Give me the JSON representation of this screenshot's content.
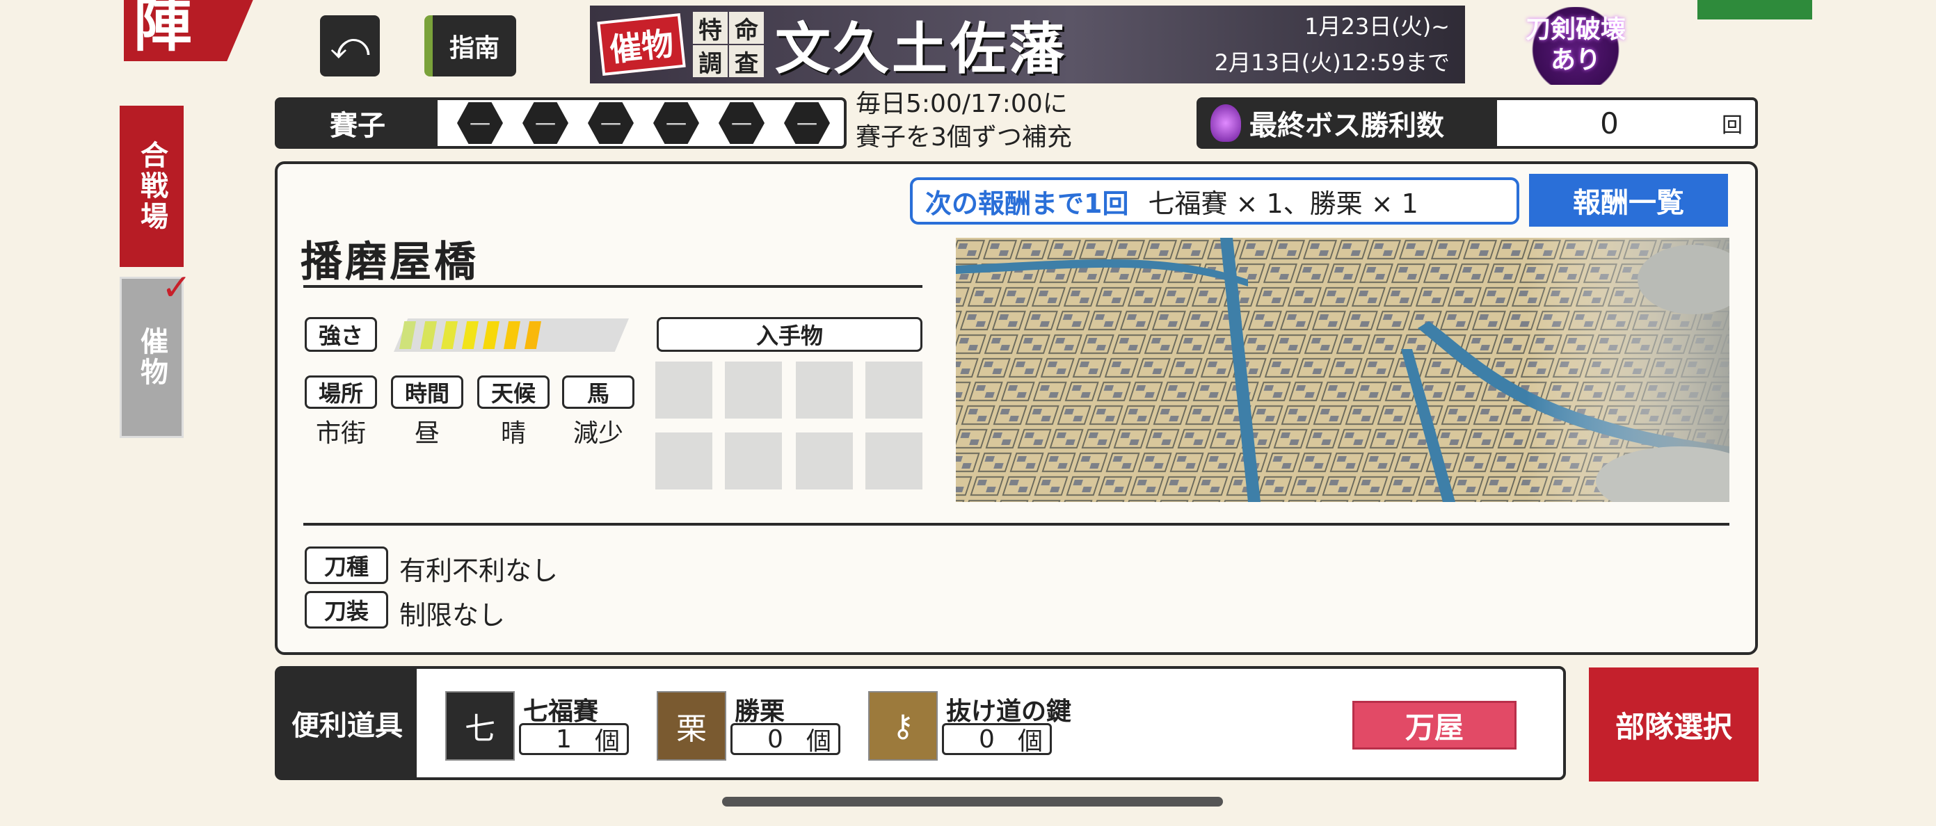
{
  "header": {
    "jin_label": "陣",
    "back_icon": "undo-arrow-icon",
    "guide_label": "指南",
    "banner": {
      "event_label": "催物",
      "tokumei_chars": [
        "特",
        "命",
        "調",
        "査"
      ],
      "title": "文久土佐藩",
      "date_start": "1月23日(火)~",
      "date_end": "2月13日(火)12:59まで"
    },
    "sword_break": [
      "刀剣破壊",
      "あり"
    ]
  },
  "side_tabs": {
    "battle": "合戦場",
    "event": "催物"
  },
  "dice": {
    "label": "賽子",
    "faces": [
      "一",
      "一",
      "一",
      "一",
      "一",
      "一"
    ],
    "refill_line1": "毎日5:00/17:00に",
    "refill_line2": "賽子を3個ずつ補充"
  },
  "boss": {
    "label": "最終ボス勝利数",
    "value": "0",
    "unit": "回"
  },
  "reward": {
    "next_label": "次の報酬まで1回",
    "next_items": "七福賽 × 1、勝栗 × 1",
    "list_button": "報酬一覧"
  },
  "stage": {
    "name": "播磨屋橋",
    "strength_label": "強さ",
    "strength_filled_segments": 7,
    "strength_total_segments": 10,
    "conditions": [
      {
        "label": "場所",
        "value": "市街"
      },
      {
        "label": "時間",
        "value": "昼"
      },
      {
        "label": "天候",
        "value": "晴"
      },
      {
        "label": "馬",
        "value": "減少"
      }
    ],
    "items_label": "入手物",
    "sword_type_label": "刀種",
    "sword_type_value": "有利不利なし",
    "equip_label": "刀装",
    "equip_value": "制限なし"
  },
  "tools": {
    "label": "便利道具",
    "items": [
      {
        "name": "七福賽",
        "count": "1",
        "unit": "個",
        "icon": "lucky-dice-icon",
        "glyph": "七"
      },
      {
        "name": "勝栗",
        "count": "0",
        "unit": "個",
        "icon": "chestnut-bag-icon",
        "glyph": "栗"
      },
      {
        "name": "抜け道の鍵",
        "count": "0",
        "unit": "個",
        "icon": "key-icon",
        "glyph": "⚷"
      }
    ],
    "shop_button": "万屋",
    "squad_button": "部隊選択"
  },
  "colors": {
    "red": "#b71c25",
    "blue": "#2a6fd8",
    "dark": "#2a2a2a",
    "background": "#f7f2e6"
  }
}
